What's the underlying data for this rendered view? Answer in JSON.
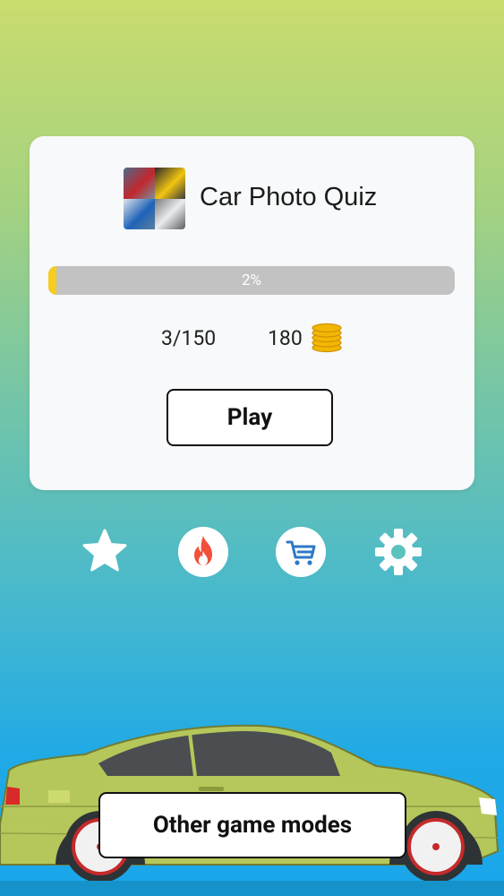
{
  "quiz": {
    "title": "Car Photo Quiz",
    "thumbnail_icon": "car-collage-icon",
    "progress_percent": 2,
    "progress_label": "2%",
    "level_progress": "3/150",
    "coins": "180",
    "play_label": "Play"
  },
  "actions": [
    {
      "name": "favorites",
      "icon": "star-icon"
    },
    {
      "name": "hot",
      "icon": "flame-icon"
    },
    {
      "name": "shop",
      "icon": "cart-icon"
    },
    {
      "name": "settings",
      "icon": "gear-icon"
    }
  ],
  "footer": {
    "other_modes_label": "Other game modes"
  },
  "colors": {
    "progress_fill": "#f6cc1d",
    "progress_track": "#c2c2c2",
    "flame": "#f2503b",
    "cart": "#2c7ac4",
    "car_body": "#b5c75a"
  }
}
